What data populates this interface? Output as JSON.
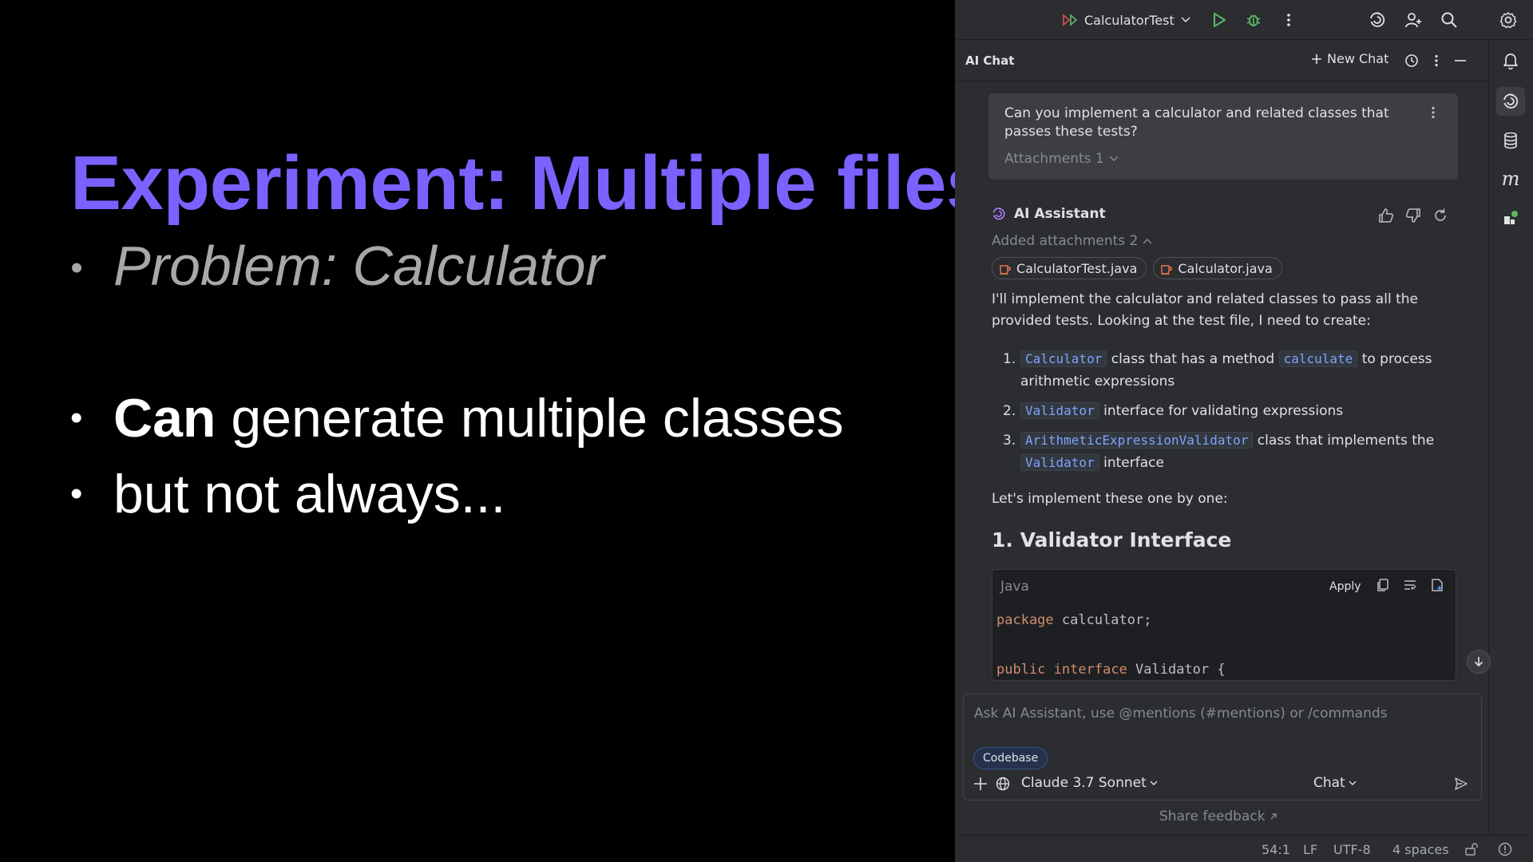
{
  "slide": {
    "title": "Experiment: Multiple files",
    "bullets": {
      "b1": "Problem: Calculator",
      "b2_bold": "Can",
      "b2_rest": " generate multiple classes",
      "b3": "but not always..."
    }
  },
  "toolbar": {
    "run_config": "CalculatorTest"
  },
  "chat": {
    "title": "AI Chat",
    "new_chat_label": "New Chat",
    "user_message": "Can you implement a calculator and related classes that passes these tests?",
    "attachments_label": "Attachments 1",
    "assistant_name": "AI Assistant",
    "added_attachments_label": "Added attachments 2",
    "attachment_chips": [
      "CalculatorTest.java",
      "Calculator.java"
    ],
    "intro": "I'll implement the calculator and related classes to pass all the provided tests. Looking at the test file, I need to create:",
    "plan": [
      {
        "num": "1.",
        "code": "Calculator",
        "text1": " class that has a method ",
        "code2": "calculate",
        "text2": " to process arithmetic expressions"
      },
      {
        "num": "2.",
        "code": "Validator",
        "text1": " interface for validating expressions"
      },
      {
        "num": "3.",
        "code": "ArithmeticExpressionValidator",
        "text1": " class that implements the ",
        "code2": "Validator",
        "text2": " interface"
      }
    ],
    "outro": "Let's implement these one by one:",
    "section_heading": "1. Validator Interface",
    "code_block": {
      "language": "Java",
      "apply_label": "Apply",
      "line1_kw": "package",
      "line1_rest": " calculator;",
      "line3_kw1": "public",
      "line3_kw2": "interface",
      "line3_rest": " Validator {"
    },
    "input_placeholder": "Ask AI Assistant, use @mentions (#mentions) or /commands",
    "codebase_chip": "Codebase",
    "model": "Claude 3.7 Sonnet",
    "mode": "Chat",
    "share_feedback": "Share feedback"
  },
  "statusbar": {
    "position": "54:1",
    "line_sep": "LF",
    "encoding": "UTF-8",
    "indent": "4 spaces"
  },
  "colors": {
    "title_purple": "#7b61ff",
    "keyword_orange": "#cf8e6d",
    "inline_code_blue": "#7ea3ff",
    "run_green": "#5fb865"
  },
  "icons": [
    "run-icon",
    "debug-icon",
    "more-vert-icon",
    "ai-spiral-icon",
    "add-user-icon",
    "search-icon",
    "gear-icon",
    "history-icon",
    "minimize-icon",
    "bell-icon",
    "database-icon",
    "italic-m-icon",
    "plugin-icon",
    "thumbs-up-icon",
    "thumbs-down-icon",
    "regenerate-icon",
    "copy-icon",
    "wrap-icon",
    "insert-file-icon",
    "arrow-down-icon",
    "plus-icon",
    "globe-icon",
    "send-icon",
    "lock-icon",
    "warning-icon"
  ]
}
